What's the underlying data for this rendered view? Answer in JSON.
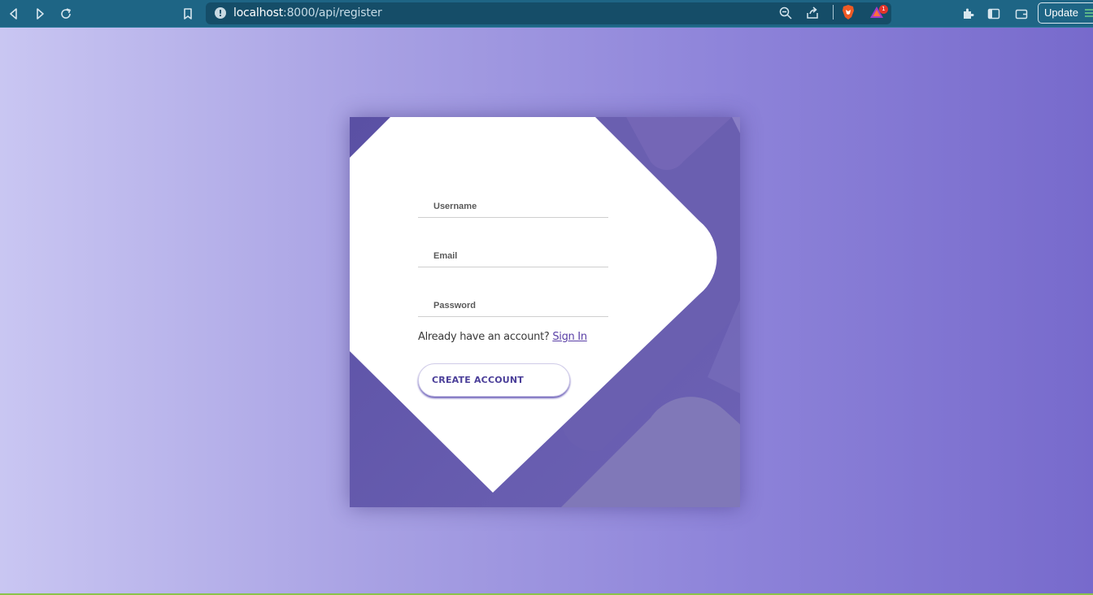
{
  "browser": {
    "url_host": "localhost",
    "url_path": ":8000/api/register",
    "update_label": "Update",
    "rewards_badge": "1",
    "icons": [
      "back-icon",
      "forward-icon",
      "reload-icon",
      "bookmark-icon",
      "info-icon",
      "zoom-icon",
      "share-icon",
      "brave-shields-icon",
      "brave-rewards-icon",
      "extensions-icon",
      "sidebar-icon",
      "wallet-icon"
    ]
  },
  "form": {
    "username_placeholder": "Username",
    "email_placeholder": "Email",
    "password_placeholder": "Password",
    "signin_prompt": "Already have an account?",
    "signin_link": "Sign In",
    "create_button": "CREATE ACCOUNT"
  },
  "colors": {
    "toolbar": "#1e6585",
    "card_purple": "#5f55a8",
    "accent": "#4b3f99",
    "page_gradient_start": "#c9c6f2",
    "page_gradient_end": "#776acc"
  }
}
